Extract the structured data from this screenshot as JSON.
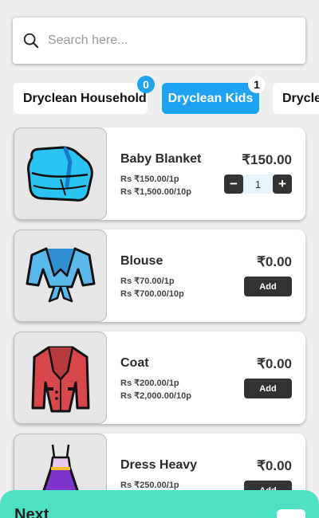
{
  "search": {
    "placeholder": "Search here...",
    "value": ""
  },
  "tabs": [
    {
      "label": "Dryclean Household",
      "badge": "0",
      "active": false
    },
    {
      "label": "Dryclean Kids",
      "badge": "1",
      "active": true
    },
    {
      "label": "Dryclean",
      "active": false
    }
  ],
  "products": [
    {
      "name": "Baby Blanket",
      "rate1": "Rs ₹150.00/1p",
      "rate2": "Rs ₹1,500.00/10p",
      "price": "₹150.00",
      "quantity": "1",
      "image": "blanket-icon"
    },
    {
      "name": "Blouse",
      "rate1": "Rs ₹70.00/1p",
      "rate2": "Rs ₹700.00/10p",
      "price": "₹0.00",
      "add_label": "Add",
      "image": "blouse-icon"
    },
    {
      "name": "Coat",
      "rate1": "Rs ₹200.00/1p",
      "rate2": "Rs ₹2,000.00/10p",
      "price": "₹0.00",
      "add_label": "Add",
      "image": "coat-icon"
    },
    {
      "name": "Dress Heavy",
      "rate1": "Rs ₹250.00/1p",
      "price": "₹0.00",
      "add_label": "Add",
      "image": "dress-icon"
    }
  ],
  "stepper": {
    "minus": "−",
    "plus": "+"
  },
  "footer": {
    "next_label": "Next"
  },
  "colors": {
    "accent": "#1ea3f0",
    "footer": "#4ee0c3",
    "button_dark": "#333333"
  }
}
